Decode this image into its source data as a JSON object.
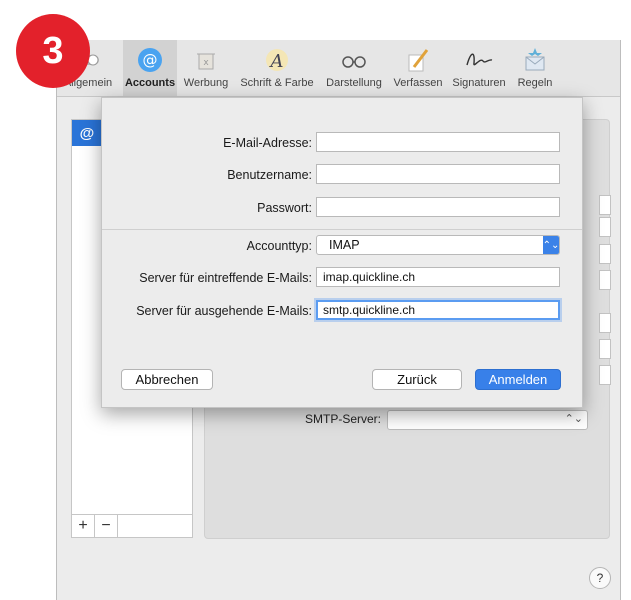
{
  "step_badge": "3",
  "toolbar": {
    "items": [
      {
        "label": "Allgemein",
        "icon": "switch-icon"
      },
      {
        "label": "Accounts",
        "icon": "at-sign-icon"
      },
      {
        "label": "Werbung",
        "icon": "trash-icon"
      },
      {
        "label": "Schrift & Farbe",
        "icon": "font-color-icon"
      },
      {
        "label": "Darstellung",
        "icon": "glasses-icon"
      },
      {
        "label": "Verfassen",
        "icon": "pencil-icon"
      },
      {
        "label": "Signaturen",
        "icon": "signature-icon"
      },
      {
        "label": "Regeln",
        "icon": "rules-icon"
      }
    ],
    "selected": "Accounts"
  },
  "account_list": {
    "selected_icon": "@",
    "add_label": "+",
    "remove_label": "−"
  },
  "detail": {
    "smtp_label": "SMTP-Server:"
  },
  "sheet": {
    "email": {
      "label": "E-Mail-Adresse:",
      "value": ""
    },
    "username": {
      "label": "Benutzername:",
      "value": ""
    },
    "password": {
      "label": "Passwort:",
      "value": ""
    },
    "account_type": {
      "label": "Accounttyp:",
      "value": "IMAP"
    },
    "incoming": {
      "label": "Server für eintreffende E-Mails:",
      "value": "imap.quickline.ch"
    },
    "outgoing": {
      "label": "Server für ausgehende E-Mails:",
      "value": "smtp.quickline.ch"
    },
    "cancel_label": "Abbrechen",
    "back_label": "Zurück",
    "signin_label": "Anmelden"
  },
  "help_label": "?",
  "colors": {
    "accent": "#3880e9",
    "badge": "#e3212b"
  }
}
